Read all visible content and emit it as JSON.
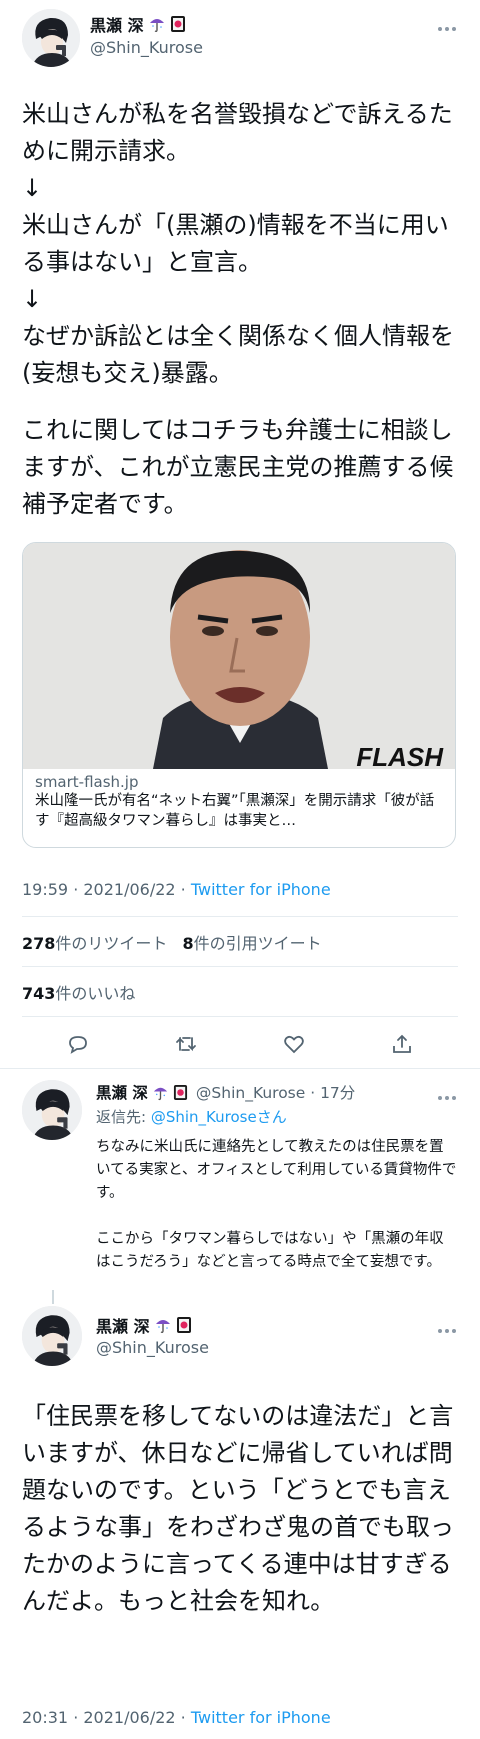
{
  "main_tweet": {
    "display_name": "黒瀬 深",
    "handle": "@Shin_Kurose",
    "text_part1": "米山さんが私を名誉毀損などで訴えるために開示請求。\n↓\n米山さんが「(黒瀬の)情報を不当に用いる事はない」と宣言。\n↓\nなぜか訴訟とは全く関係なく個人情報を(妄想も交え)暴露。",
    "text_part2": "これに関してはコチラも弁護士に相談しますが、これが立憲民主党の推薦する候補予定者です。",
    "card": {
      "domain": "smart-flash.jp",
      "title": "米山隆一氏が有名“ネット右翼”「黒瀬深」を開示請求「彼が話す『超高級タワマン暮らし』は事実と…",
      "watermark": "FLASH"
    },
    "time": "19:59 · 2021/06/22 ·",
    "source": "Twitter for iPhone",
    "retweets_count": "278",
    "retweets_label": "件のリツイート",
    "quotes_count": "8",
    "quotes_label": "件の引用ツイート",
    "likes_count": "743",
    "likes_label": "件のいいね"
  },
  "reply_tweet": {
    "display_name": "黒瀬 深",
    "handle_time": "@Shin_Kurose · 17分",
    "reply_prefix": "返信先: ",
    "reply_to": "@Shin_Kurose",
    "reply_suffix": "さん",
    "text": "ちなみに米山氏に連絡先として教えたのは住民票を置いてる実家と、オフィスとして利用している賃貸物件です。\n\nここから「タワマン暮らしではない」や「黒瀬の年収はこうだろう」などと言ってる時点で全て妄想です。"
  },
  "third_tweet": {
    "display_name": "黒瀬 深",
    "handle": "@Shin_Kurose",
    "text": "「住民票を移してないのは違法だ」と言いますが、休日などに帰省していれば問題ないのです。という「どうとでも言えるような事」をわざわざ鬼の首でも取ったかのように言ってくる連中は甘すぎるんだよ。もっと社会を知れ。",
    "time": "20:31 · 2021/06/22 ·",
    "source": "Twitter for iPhone"
  },
  "icons": [
    "umbrella-emoji-icon",
    "hanafuda-card-emoji-icon",
    "more-icon",
    "reply-icon",
    "retweet-icon",
    "like-icon",
    "share-icon"
  ],
  "colors": {
    "link": "#1d9bf0",
    "secondary_text": "#536471",
    "divider": "#e6ecf0"
  }
}
